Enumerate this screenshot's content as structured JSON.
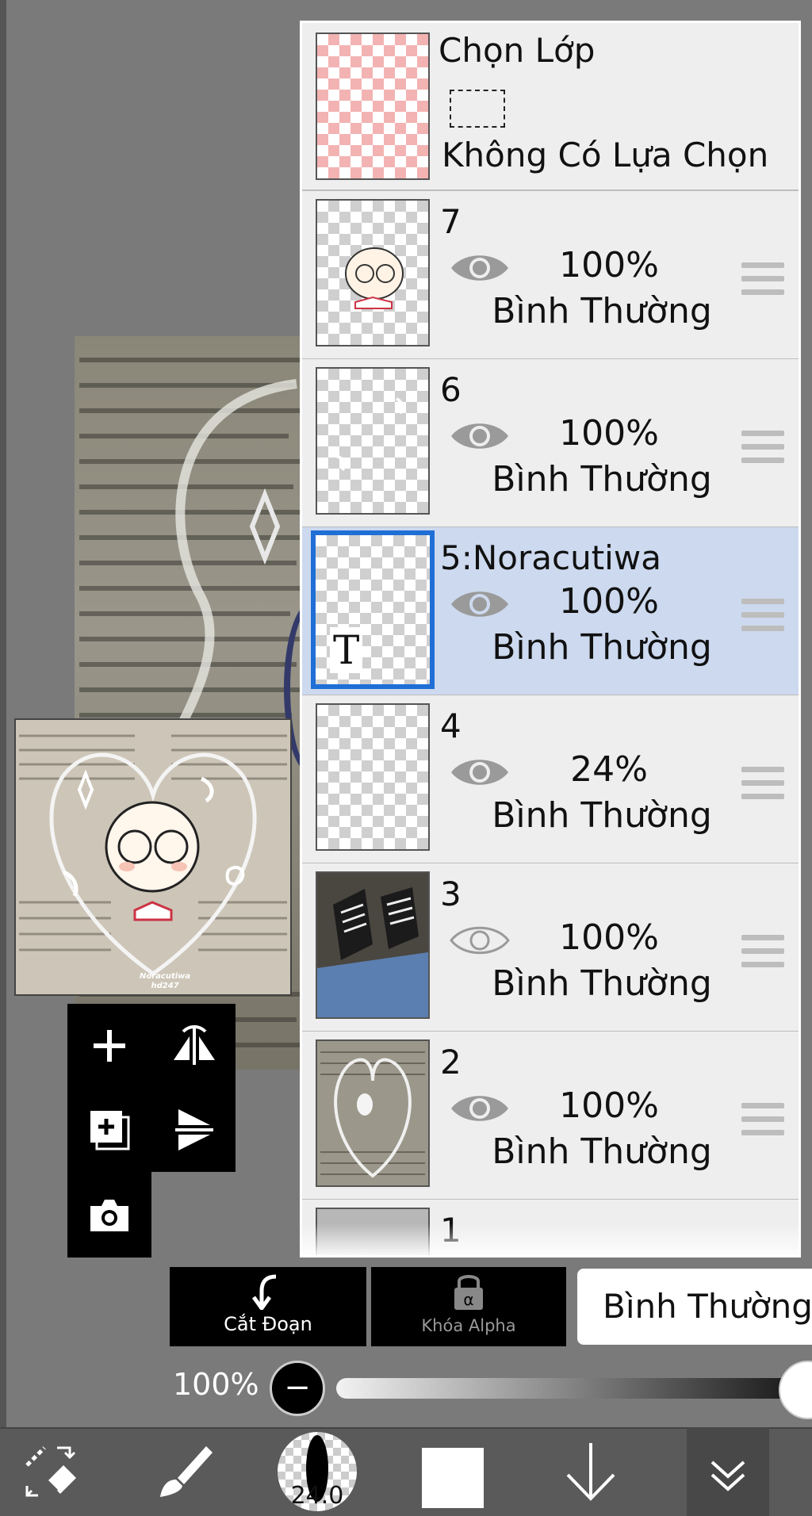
{
  "layers_panel": {
    "selection": {
      "title": "Chọn Lớp",
      "status": "Không Có Lựa Chọn"
    },
    "layers": [
      {
        "name": "7",
        "opacity": "100%",
        "blend": "Bình Thường",
        "visible": true,
        "active": false
      },
      {
        "name": "6",
        "opacity": "100%",
        "blend": "Bình Thường",
        "visible": true,
        "active": false
      },
      {
        "name": "5:Noracutiwa",
        "opacity": "100%",
        "blend": "Bình Thường",
        "visible": true,
        "active": true,
        "thumb_text": "T"
      },
      {
        "name": "4",
        "opacity": "24%",
        "blend": "Bình Thường",
        "visible": true,
        "active": false
      },
      {
        "name": "3",
        "opacity": "100%",
        "blend": "Bình Thường",
        "visible": false,
        "active": false
      },
      {
        "name": "2",
        "opacity": "100%",
        "blend": "Bình Thường",
        "visible": true,
        "active": false
      },
      {
        "name": "1"
      }
    ]
  },
  "actions": {
    "clipping_label": "Cắt Đoạn",
    "alpha_lock_label": "Khóa Alpha",
    "blend_mode_value": "Bình Thường"
  },
  "opacity_control": {
    "value_text": "100%",
    "level": 1.0
  },
  "bottom_toolbar": {
    "brush_size": "24.0",
    "color": "#ffffff"
  },
  "preview": {
    "watermark": "Noracutiwa\nhd247"
  },
  "colors": {
    "active_layer_bg": "#ccd9ee",
    "active_border": "#1f6fd6",
    "panel_bg": "#eeeeee"
  }
}
